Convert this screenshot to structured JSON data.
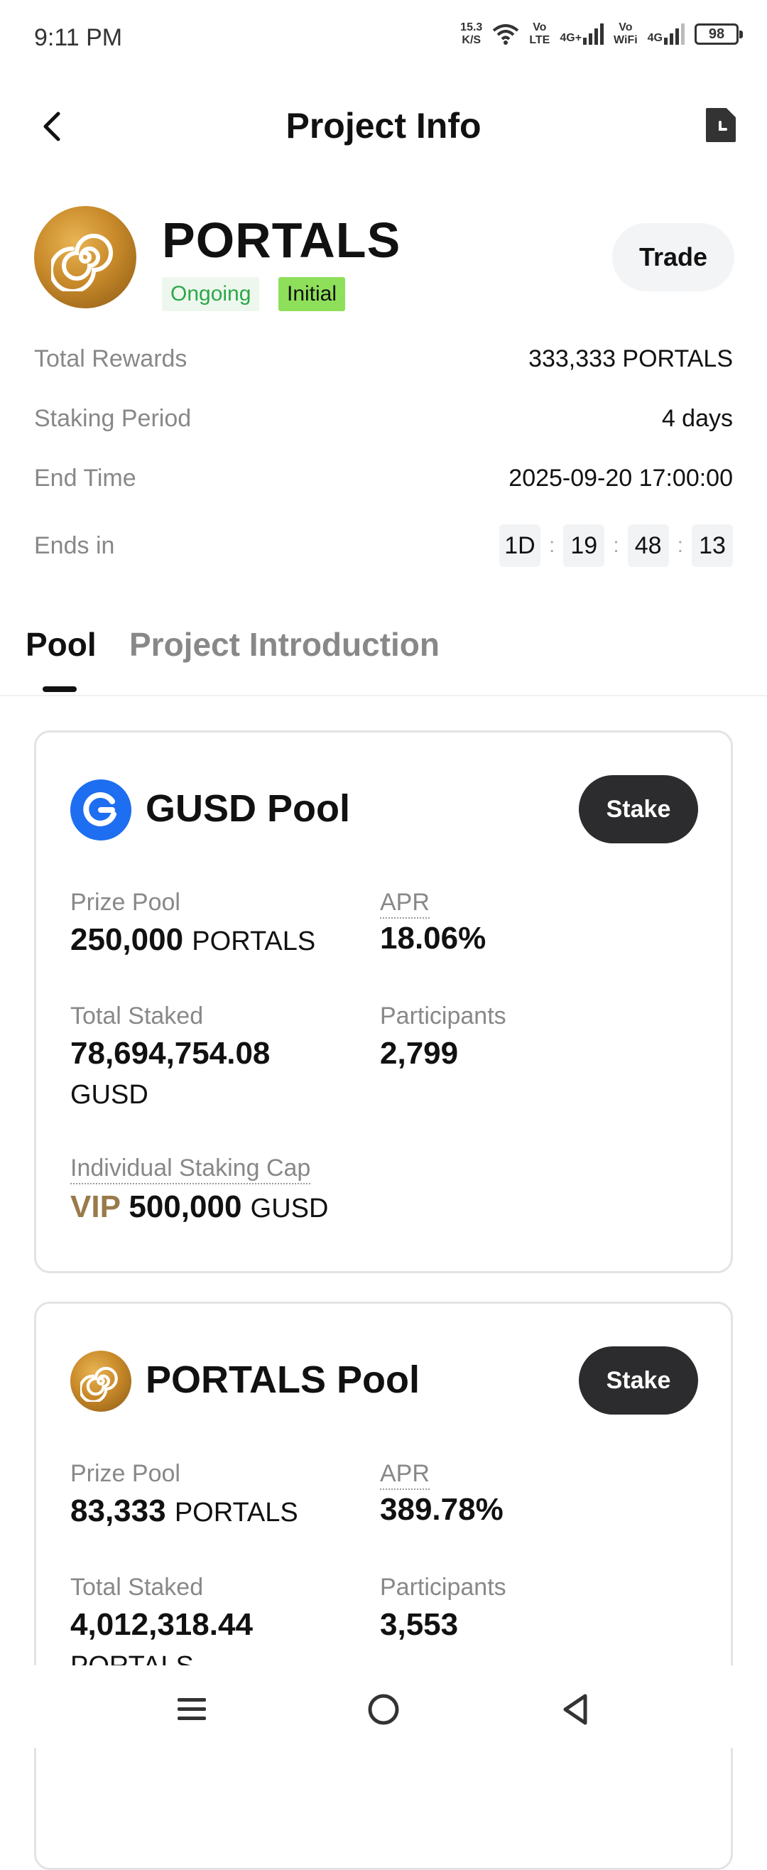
{
  "status_bar": {
    "time": "9:11 PM",
    "net_speed_value": "15.3",
    "net_speed_unit": "K/S",
    "volte_top": "Vo",
    "volte_bottom": "LTE",
    "signal1_label": "4G+",
    "vowifi_top": "Vo",
    "vowifi_bottom": "WiFi",
    "signal2_label": "4G",
    "battery": "98"
  },
  "header": {
    "title": "Project Info",
    "back_icon": "chevron-left-icon",
    "doc_icon": "document-clock-icon"
  },
  "project": {
    "name": "PORTALS",
    "status_badge": "Ongoing",
    "stage_badge": "Initial",
    "trade_label": "Trade",
    "colors": {
      "ongoing": "#2ba84a",
      "initial_bg": "#8ee05a",
      "logo": "#c98a2a"
    }
  },
  "info": {
    "total_rewards_label": "Total Rewards",
    "total_rewards_value": "333,333 PORTALS",
    "staking_period_label": "Staking Period",
    "staking_period_value": "4 days",
    "end_time_label": "End Time",
    "end_time_value": "2025-09-20 17:00:00",
    "ends_in_label": "Ends in",
    "countdown": {
      "days": "1D",
      "hours": "19",
      "minutes": "48",
      "seconds": "13"
    }
  },
  "tabs": {
    "pool": "Pool",
    "intro": "Project Introduction"
  },
  "pools": [
    {
      "title": "GUSD Pool",
      "stake_label": "Stake",
      "prize_pool_label": "Prize Pool",
      "prize_pool_value": "250,000",
      "prize_pool_unit": "PORTALS",
      "apr_label": "APR",
      "apr_value": "18.06%",
      "total_staked_label": "Total Staked",
      "total_staked_value": "78,694,754.08",
      "total_staked_unit": "GUSD",
      "participants_label": "Participants",
      "participants_value": "2,799",
      "cap_label": "Individual Staking Cap",
      "cap_vip": "VIP",
      "cap_value": "500,000",
      "cap_unit": "GUSD"
    },
    {
      "title": "PORTALS Pool",
      "stake_label": "Stake",
      "prize_pool_label": "Prize Pool",
      "prize_pool_value": "83,333",
      "prize_pool_unit": "PORTALS",
      "apr_label": "APR",
      "apr_value": "389.78%",
      "total_staked_label": "Total Staked",
      "total_staked_value": "4,012,318.44",
      "total_staked_unit": "PORTALS",
      "participants_label": "Participants",
      "participants_value": "3,553"
    }
  ],
  "nav": {
    "menu_icon": "menu-icon",
    "home_icon": "home-circle-icon",
    "back_icon": "back-triangle-icon"
  }
}
